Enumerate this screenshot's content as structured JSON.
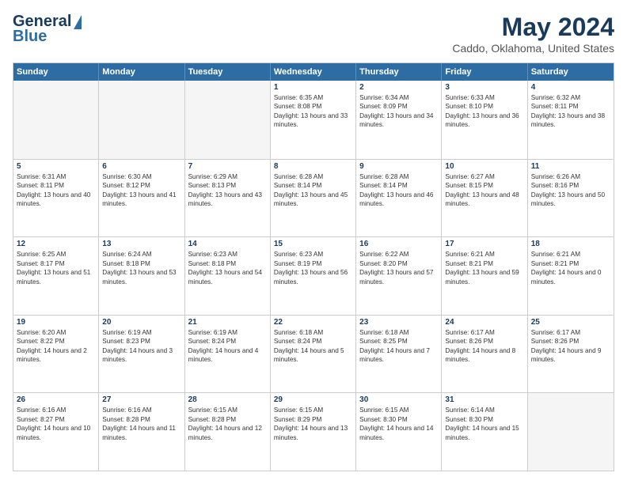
{
  "header": {
    "logo_line1": "General",
    "logo_line2": "Blue",
    "main_title": "May 2024",
    "subtitle": "Caddo, Oklahoma, United States"
  },
  "weekdays": [
    "Sunday",
    "Monday",
    "Tuesday",
    "Wednesday",
    "Thursday",
    "Friday",
    "Saturday"
  ],
  "weeks": [
    [
      {
        "day": "",
        "content": ""
      },
      {
        "day": "",
        "content": ""
      },
      {
        "day": "",
        "content": ""
      },
      {
        "day": "1",
        "content": "Sunrise: 6:35 AM\nSunset: 8:08 PM\nDaylight: 13 hours and 33 minutes."
      },
      {
        "day": "2",
        "content": "Sunrise: 6:34 AM\nSunset: 8:09 PM\nDaylight: 13 hours and 34 minutes."
      },
      {
        "day": "3",
        "content": "Sunrise: 6:33 AM\nSunset: 8:10 PM\nDaylight: 13 hours and 36 minutes."
      },
      {
        "day": "4",
        "content": "Sunrise: 6:32 AM\nSunset: 8:11 PM\nDaylight: 13 hours and 38 minutes."
      }
    ],
    [
      {
        "day": "5",
        "content": "Sunrise: 6:31 AM\nSunset: 8:11 PM\nDaylight: 13 hours and 40 minutes."
      },
      {
        "day": "6",
        "content": "Sunrise: 6:30 AM\nSunset: 8:12 PM\nDaylight: 13 hours and 41 minutes."
      },
      {
        "day": "7",
        "content": "Sunrise: 6:29 AM\nSunset: 8:13 PM\nDaylight: 13 hours and 43 minutes."
      },
      {
        "day": "8",
        "content": "Sunrise: 6:28 AM\nSunset: 8:14 PM\nDaylight: 13 hours and 45 minutes."
      },
      {
        "day": "9",
        "content": "Sunrise: 6:28 AM\nSunset: 8:14 PM\nDaylight: 13 hours and 46 minutes."
      },
      {
        "day": "10",
        "content": "Sunrise: 6:27 AM\nSunset: 8:15 PM\nDaylight: 13 hours and 48 minutes."
      },
      {
        "day": "11",
        "content": "Sunrise: 6:26 AM\nSunset: 8:16 PM\nDaylight: 13 hours and 50 minutes."
      }
    ],
    [
      {
        "day": "12",
        "content": "Sunrise: 6:25 AM\nSunset: 8:17 PM\nDaylight: 13 hours and 51 minutes."
      },
      {
        "day": "13",
        "content": "Sunrise: 6:24 AM\nSunset: 8:18 PM\nDaylight: 13 hours and 53 minutes."
      },
      {
        "day": "14",
        "content": "Sunrise: 6:23 AM\nSunset: 8:18 PM\nDaylight: 13 hours and 54 minutes."
      },
      {
        "day": "15",
        "content": "Sunrise: 6:23 AM\nSunset: 8:19 PM\nDaylight: 13 hours and 56 minutes."
      },
      {
        "day": "16",
        "content": "Sunrise: 6:22 AM\nSunset: 8:20 PM\nDaylight: 13 hours and 57 minutes."
      },
      {
        "day": "17",
        "content": "Sunrise: 6:21 AM\nSunset: 8:21 PM\nDaylight: 13 hours and 59 minutes."
      },
      {
        "day": "18",
        "content": "Sunrise: 6:21 AM\nSunset: 8:21 PM\nDaylight: 14 hours and 0 minutes."
      }
    ],
    [
      {
        "day": "19",
        "content": "Sunrise: 6:20 AM\nSunset: 8:22 PM\nDaylight: 14 hours and 2 minutes."
      },
      {
        "day": "20",
        "content": "Sunrise: 6:19 AM\nSunset: 8:23 PM\nDaylight: 14 hours and 3 minutes."
      },
      {
        "day": "21",
        "content": "Sunrise: 6:19 AM\nSunset: 8:24 PM\nDaylight: 14 hours and 4 minutes."
      },
      {
        "day": "22",
        "content": "Sunrise: 6:18 AM\nSunset: 8:24 PM\nDaylight: 14 hours and 5 minutes."
      },
      {
        "day": "23",
        "content": "Sunrise: 6:18 AM\nSunset: 8:25 PM\nDaylight: 14 hours and 7 minutes."
      },
      {
        "day": "24",
        "content": "Sunrise: 6:17 AM\nSunset: 8:26 PM\nDaylight: 14 hours and 8 minutes."
      },
      {
        "day": "25",
        "content": "Sunrise: 6:17 AM\nSunset: 8:26 PM\nDaylight: 14 hours and 9 minutes."
      }
    ],
    [
      {
        "day": "26",
        "content": "Sunrise: 6:16 AM\nSunset: 8:27 PM\nDaylight: 14 hours and 10 minutes."
      },
      {
        "day": "27",
        "content": "Sunrise: 6:16 AM\nSunset: 8:28 PM\nDaylight: 14 hours and 11 minutes."
      },
      {
        "day": "28",
        "content": "Sunrise: 6:15 AM\nSunset: 8:28 PM\nDaylight: 14 hours and 12 minutes."
      },
      {
        "day": "29",
        "content": "Sunrise: 6:15 AM\nSunset: 8:29 PM\nDaylight: 14 hours and 13 minutes."
      },
      {
        "day": "30",
        "content": "Sunrise: 6:15 AM\nSunset: 8:30 PM\nDaylight: 14 hours and 14 minutes."
      },
      {
        "day": "31",
        "content": "Sunrise: 6:14 AM\nSunset: 8:30 PM\nDaylight: 14 hours and 15 minutes."
      },
      {
        "day": "",
        "content": ""
      }
    ]
  ]
}
